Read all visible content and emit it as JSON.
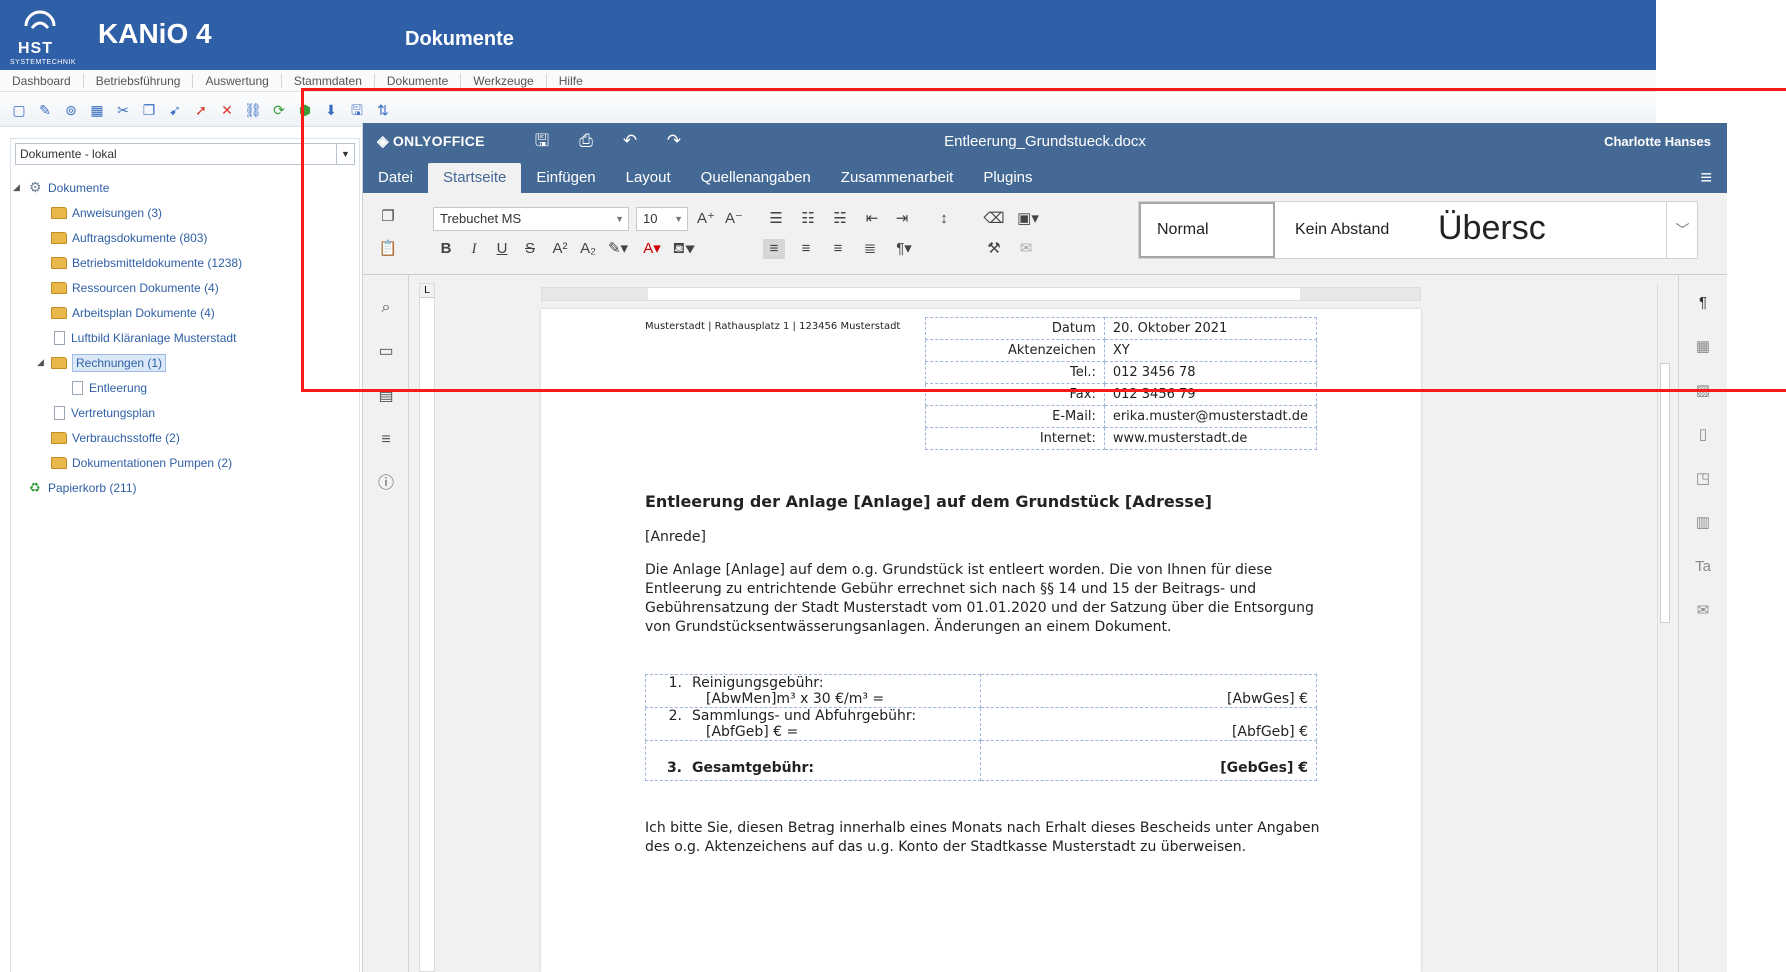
{
  "kanio": {
    "logo_text": "HST",
    "logo_subtext": "SYSTEMTECHNIK",
    "app_title": "KANiO 4",
    "page_title": "Dokumente",
    "menu": [
      "Dashboard",
      "Betriebsführung",
      "Auswertung",
      "Stammdaten",
      "Dokumente",
      "Werkzeuge",
      "Hilfe"
    ],
    "toolbar_icons": [
      "new-document-icon",
      "edit-icon",
      "binoculars-icon",
      "table-icon",
      "cut-icon",
      "copy-icon",
      "paste-icon",
      "move-icon",
      "delete-icon",
      "link-icon",
      "refresh-icon",
      "export-icon",
      "import-icon",
      "save-icon",
      "sort-icon"
    ],
    "repository_select": "Dokumente - lokal",
    "tree": [
      {
        "label": "Dokumente",
        "type": "root"
      },
      {
        "label": "Anweisungen (3)",
        "type": "folder"
      },
      {
        "label": "Auftragsdokumente (803)",
        "type": "folder"
      },
      {
        "label": "Betriebsmitteldokumente (1238)",
        "type": "folder"
      },
      {
        "label": "Ressourcen Dokumente (4)",
        "type": "folder"
      },
      {
        "label": "Arbeitsplan Dokumente (4)",
        "type": "folder"
      },
      {
        "label": "Luftbild Kläranlage Musterstadt",
        "type": "doc"
      },
      {
        "label": "Rechnungen (1)",
        "type": "folder",
        "selected": true
      },
      {
        "label": "Entleerung",
        "type": "doc",
        "child": true
      },
      {
        "label": "Vertretungsplan",
        "type": "doc"
      },
      {
        "label": "Verbrauchsstoffe (2)",
        "type": "folder"
      },
      {
        "label": "Dokumentationen Pumpen (2)",
        "type": "folder"
      },
      {
        "label": "Papierkorb (211)",
        "type": "bin"
      }
    ]
  },
  "editor": {
    "brand": "ONLYOFFICE",
    "document_name": "Entleerung_Grundstueck.docx",
    "user": "Charlotte Hanses",
    "tabs": [
      "Datei",
      "Startseite",
      "Einfügen",
      "Layout",
      "Quellenangaben",
      "Zusammenarbeit",
      "Plugins"
    ],
    "active_tab": "Startseite",
    "font_name": "Trebuchet MS",
    "font_size": "10",
    "styles": [
      "Normal",
      "Kein Abstand",
      "Übersc"
    ]
  },
  "document": {
    "sender_line": "Musterstadt | Rathausplatz 1 | 123456 Musterstadt",
    "info": [
      {
        "label": "Datum",
        "value": "20. Oktober 2021"
      },
      {
        "label": "Aktenzeichen",
        "value": "XY"
      },
      {
        "label": "Tel.:",
        "value": "012 3456 78"
      },
      {
        "label": "Fax:",
        "value": "012 3456 79"
      },
      {
        "label": "E-Mail:",
        "value": "erika.muster@musterstadt.de"
      },
      {
        "label": "Internet:",
        "value": "www.musterstadt.de"
      }
    ],
    "heading": "Entleerung der Anlage [Anlage] auf dem Grundstück [Adresse]",
    "salutation": "[Anrede]",
    "body": "Die Anlage [Anlage] auf dem o.g. Grundstück ist entleert worden. Die von Ihnen für diese Entleerung zu entrichtende Gebühr errechnet sich nach §§ 14 und 15 der Beitrags- und Gebührensatzung der Stadt Musterstadt vom 01.01.2020 und der Satzung über die Entsorgung von Grundstücksentwässerungsanlagen. Änderungen an einem Dokument.",
    "fees": [
      {
        "num": "1.",
        "line1": "Reinigungsgebühr:",
        "line2": "[AbwMen]m³ x 30 €/m³ =",
        "amount": "[AbwGes] €"
      },
      {
        "num": "2.",
        "line1": "Sammlungs- und Abfuhrgebühr:",
        "line2": "[AbfGeb] € =",
        "amount": "[AbfGeb] €"
      },
      {
        "num": "3.",
        "line1": "Gesamtgebühr:",
        "line2": "",
        "amount": "[GebGes] €"
      }
    ],
    "closing": "Ich bitte Sie, diesen Betrag innerhalb eines Monats nach Erhalt dieses Bescheids unter Angaben des o.g. Aktenzeichens auf das u.g. Konto der Stadtkasse Musterstadt zu überweisen."
  }
}
